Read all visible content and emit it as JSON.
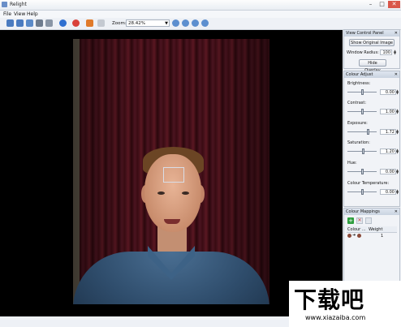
{
  "window": {
    "title": "Relight"
  },
  "menu": {
    "file": "File",
    "view": "View",
    "help": "Help"
  },
  "toolbar": {
    "zoom_label": "Zoom:",
    "zoom_value": "28.42%"
  },
  "view_control": {
    "header": "View Control Panel",
    "show_original": "Show Original Image",
    "window_radius_label": "Window Radius:",
    "window_radius_value": "100",
    "hide_overlay": "Hide Overlay"
  },
  "colour_adjust": {
    "header": "Colour Adjust",
    "brightness": {
      "label": "Brightness:",
      "value": "0.00",
      "level": 0.5
    },
    "contrast": {
      "label": "Contrast:",
      "value": "1.00",
      "level": 0.5
    },
    "exposure": {
      "label": "Exposure:",
      "value": "1.72",
      "level": 0.72
    },
    "saturation": {
      "label": "Saturation:",
      "value": "1.20",
      "level": 0.55
    },
    "hue": {
      "label": "Hue:",
      "value": "0.00",
      "level": 0.5
    },
    "colour_temperature": {
      "label": "Colour Temperature:",
      "value": "0.00",
      "level": 0.5
    }
  },
  "colour_mappings": {
    "header": "Colour Mappings",
    "col_colour": "Colour ...",
    "col_weight": "Weight",
    "rows": [
      {
        "weight": "1"
      }
    ]
  },
  "watermark": {
    "big": "下载吧",
    "small": "www.xiazaiba.com"
  },
  "colors": {
    "accent": "#3b82f6",
    "close": "#d9574a",
    "add": "#2e9e3e"
  }
}
